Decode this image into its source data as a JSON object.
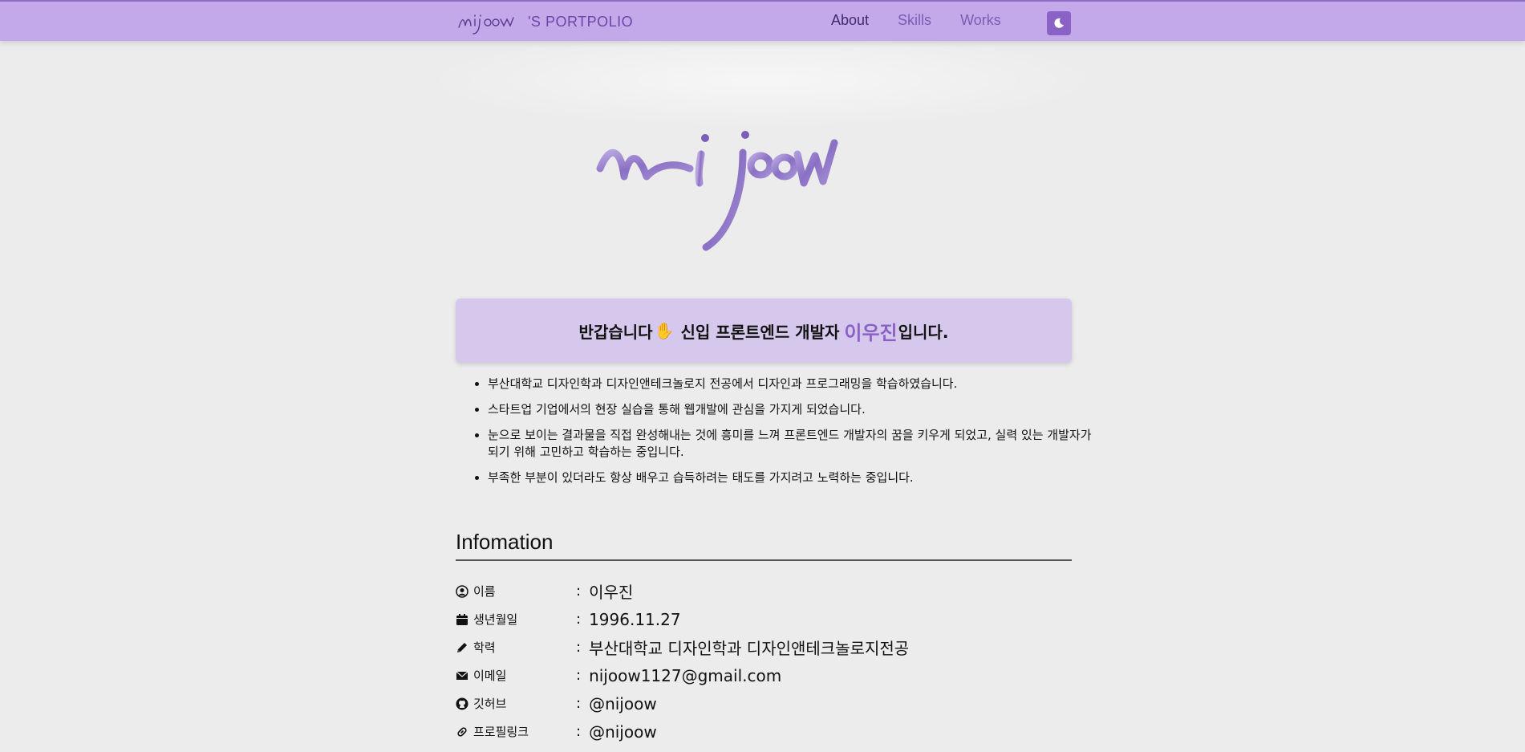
{
  "header": {
    "brand_text": "'S PORTPOLIO",
    "brand_logo_icon": "nijoow-script-logo",
    "nav": [
      {
        "label": "About",
        "active": true
      },
      {
        "label": "Skills",
        "active": false
      },
      {
        "label": "Works",
        "active": false
      }
    ],
    "theme_icon": "moon-icon",
    "colors": {
      "bar": "#c3a9ea",
      "accent": "#8a62c6"
    }
  },
  "hero": {
    "logo_icon": "nijoow-ribbon-logo"
  },
  "greeting": {
    "prefix": "반갑습니다",
    "hand_icon": "✋",
    "middle": "신입 프론트엔드 개발자",
    "name": "이우진",
    "suffix": "입니다."
  },
  "intro": [
    "부산대학교 디자인학과 디자인앤테크놀로지 전공에서 디자인과 프로그래밍을 학습하였습니다.",
    "스타트업 기업에서의 현장 실습을 통해 웹개발에 관심을 가지게 되었습니다.",
    "눈으로 보이는 결과물을 직접 완성해내는 것에 흥미를 느껴 프론트엔드 개발자의 꿈을 키우게 되었고, 실력 있는 개발자가 되기 위해 고민하고 학습하는 중입니다.",
    "부족한 부분이 있더라도 항상 배우고 습득하려는 태도를 가지려고 노력하는 중입니다."
  ],
  "info": {
    "title": "Infomation",
    "colon": ":",
    "rows": [
      {
        "icon": "user-circle-icon",
        "label": "이름",
        "value": "이우진"
      },
      {
        "icon": "calendar-icon",
        "label": "생년월일",
        "value": "1996.11.27"
      },
      {
        "icon": "pencil-icon",
        "label": "학력",
        "value": "부산대학교 디자인학과 디자인앤테크놀로지전공"
      },
      {
        "icon": "envelope-icon",
        "label": "이메일",
        "value": "nijoow1127@gmail.com"
      },
      {
        "icon": "github-icon",
        "label": "깃허브",
        "value": "@nijoow"
      },
      {
        "icon": "link-icon",
        "label": "프로필링크",
        "value": "@nijoow"
      }
    ]
  }
}
